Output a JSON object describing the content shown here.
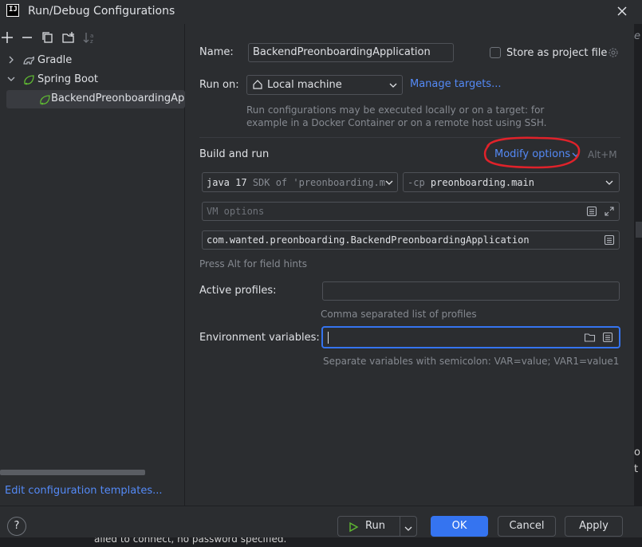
{
  "window": {
    "title": "Run/Debug Configurations",
    "app_icon": "IJ"
  },
  "toolbar": {
    "icons": [
      "add-icon",
      "remove-icon",
      "copy-icon",
      "new-folder-icon",
      "sort-icon"
    ]
  },
  "tree": {
    "items": [
      {
        "label": "Gradle",
        "icon": "gradle-icon",
        "expanded": false
      },
      {
        "label": "Spring Boot",
        "icon": "spring-boot-icon",
        "expanded": true
      },
      {
        "label": "BackendPreonboardingApp",
        "icon": "spring-boot-run-icon",
        "selected": true
      }
    ]
  },
  "edit_templates_link": "Edit configuration templates...",
  "form": {
    "name_label": "Name:",
    "name_value": "BackendPreonboardingApplication",
    "store_label": "Store as project file",
    "store_checked": false,
    "run_on_label": "Run on:",
    "run_on_value": "Local machine",
    "manage_targets": "Manage targets...",
    "run_on_hint_1": "Run configurations may be executed locally or on a target: for",
    "run_on_hint_2": "example in a Docker Container or on a remote host using SSH.",
    "build_run_title": "Build and run",
    "modify_options": "Modify options",
    "modify_shortcut": "Alt+M",
    "jdk_bold": "java 17",
    "jdk_rest": "SDK of 'preonboarding.m",
    "cp_prefix": "-cp",
    "cp_value": "preonboarding.main",
    "vm_placeholder": "VM options",
    "main_class": "com.wanted.preonboarding.BackendPreonboardingApplication",
    "field_hints": "Press Alt for field hints",
    "active_profiles_label": "Active profiles:",
    "active_profiles_value": "",
    "active_profiles_hint": "Comma separated list of profiles",
    "env_label": "Environment variables:",
    "env_value": "",
    "env_hint": "Separate variables with semicolon: VAR=value; VAR1=value1"
  },
  "buttons": {
    "run": "Run",
    "ok": "OK",
    "cancel": "Cancel",
    "apply": "Apply",
    "help": "?"
  },
  "background_edge_text": {
    "top": "e",
    "mid_1": "o",
    "mid_2": "t",
    "bottom": "ailed to connect, no password specified."
  },
  "colors": {
    "accent": "#3574f0",
    "link": "#548af7",
    "annotation": "#e0222a",
    "spring": "#5fb832"
  }
}
